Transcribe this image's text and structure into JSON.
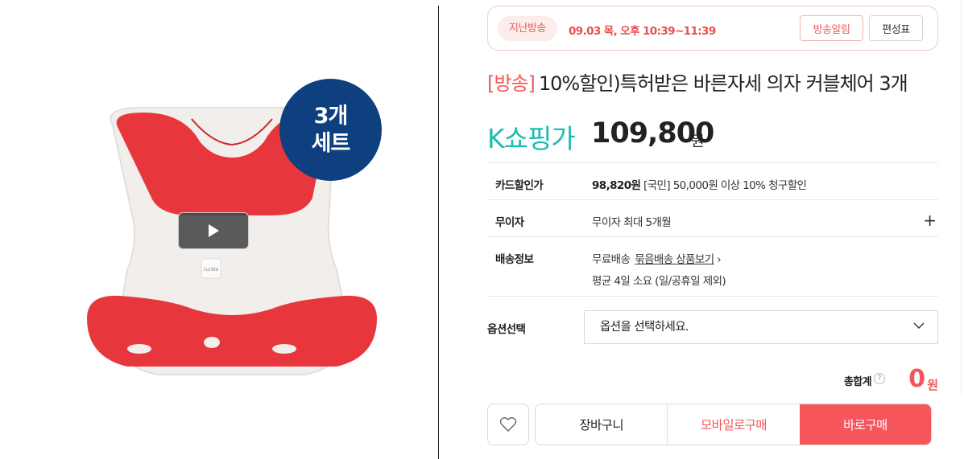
{
  "product": {
    "badge_line1": "3개",
    "badge_line2": "세트",
    "logo_text": "curble"
  },
  "broadcast": {
    "status": "지난방송",
    "air_time": "09.03 목, 오후 10:39~11:39",
    "alarm_label": "방송알림",
    "schedule_label": "편성표"
  },
  "title": {
    "tag": "[방송]",
    "text": "10%할인)특허받은 바른자세 의자 커블체어 3개"
  },
  "price": {
    "channel": "K쇼핑가",
    "amount": "109,800",
    "unit": "원"
  },
  "info": {
    "card_label": "카드할인가",
    "card_price": "98,820원",
    "card_desc": "[국민] 50,000원 이상 10% 청구할인",
    "installment_label": "무이자",
    "installment_value": "무이자 최대 5개월",
    "shipping_label": "배송정보",
    "shipping_free": "무료배송",
    "shipping_link": "묶음배송 상품보기",
    "shipping_eta": "평균 4일 소요 (일/공휴일 제외)"
  },
  "option": {
    "label": "옵션선택",
    "placeholder": "옵션을 선택하세요."
  },
  "total": {
    "label": "총합계",
    "help": "?",
    "amount": "0",
    "unit": "원"
  },
  "actions": {
    "cart": "장바구니",
    "mobile": "모바일로구매",
    "buy": "바로구매"
  },
  "colors": {
    "accent": "#f5555b",
    "channel": "#1cbdb1",
    "badge": "#0e3f7e",
    "chair_red": "#e8373c"
  }
}
